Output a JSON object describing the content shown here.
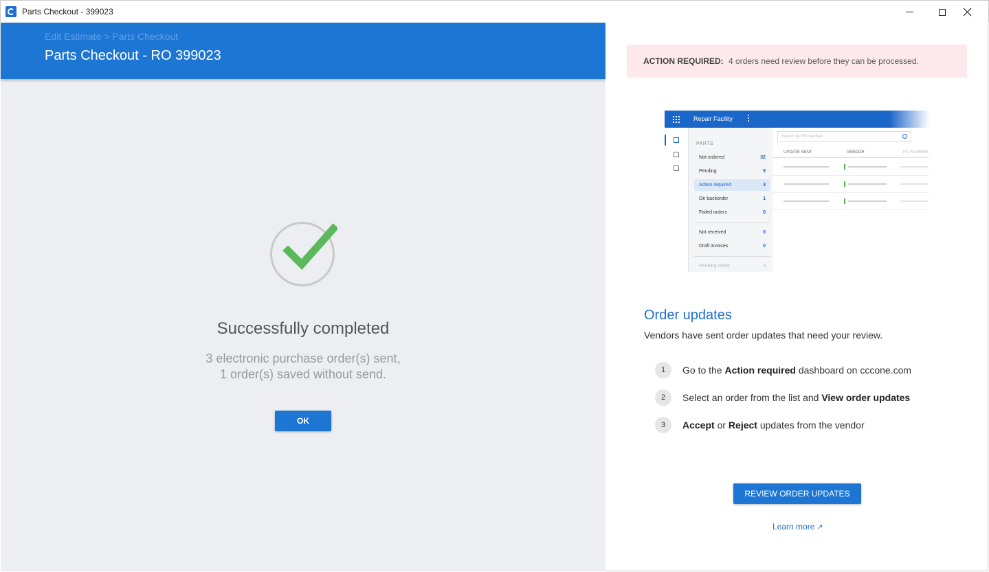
{
  "window": {
    "title": "Parts Checkout - 399023",
    "app_icon": "cccone-icon",
    "controls": [
      "minimize-icon",
      "maximize-icon",
      "close-icon"
    ]
  },
  "header": {
    "breadcrumb": "Edit Estimate > Parts Checkout",
    "title": "Parts Checkout - RO 399023"
  },
  "success": {
    "icon": "checkmark-icon",
    "title": "Successfully completed",
    "line1": "3 electronic purchase order(s) sent,",
    "line2": "1 order(s) saved without send.",
    "ok_label": "OK"
  },
  "alert": {
    "label": "ACTION REQUIRED:",
    "message": "4 orders need review before they can be processed."
  },
  "illustration": {
    "app_name": "Repair Facility",
    "search_placeholder": "Search by RO number...",
    "section_header": "PARTS",
    "items": [
      {
        "label": "Not ordered",
        "count": "32"
      },
      {
        "label": "Pending",
        "count": "9"
      },
      {
        "label": "Action required",
        "count": "3"
      },
      {
        "label": "On backorder",
        "count": "1"
      },
      {
        "label": "Failed orders",
        "count": "0"
      },
      {
        "label": "Not received",
        "count": "0"
      },
      {
        "label": "Draft invoices",
        "count": "0"
      },
      {
        "label": "Pending credit",
        "count": "3"
      }
    ],
    "columns": [
      "UPDATE SENT",
      "VENDOR",
      "PO NUMBER"
    ]
  },
  "order_updates": {
    "title": "Order updates",
    "description": "Vendors have sent order updates that need your review.",
    "steps": [
      {
        "num": "1",
        "pre": "Go to the ",
        "bold": "Action required",
        "post": " dashboard on cccone.com"
      },
      {
        "num": "2",
        "pre": "Select an order from the list and ",
        "bold": "View order updates",
        "post": ""
      },
      {
        "num": "3",
        "bold1": "Accept",
        "mid": " or ",
        "bold2": "Reject",
        "post": " updates from the vendor"
      }
    ],
    "review_label": "REVIEW ORDER UPDATES",
    "learn_more": "Learn more",
    "learn_more_icon": "external-link-icon"
  },
  "colors": {
    "primary": "#1e76d4",
    "alert_bg": "#fde9eb",
    "success_green": "#5cb85c"
  }
}
